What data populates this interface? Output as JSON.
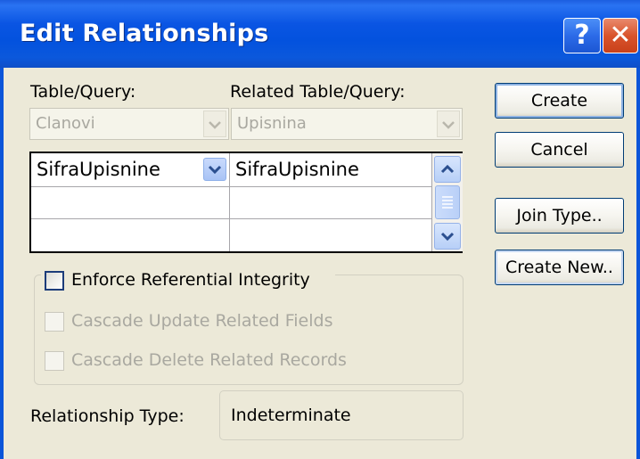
{
  "window": {
    "title": "Edit Relationships",
    "help_label": "?",
    "close_label": "✕"
  },
  "table_query": {
    "label": "Table/Query:",
    "value": "Clanovi"
  },
  "related_table_query": {
    "label": "Related Table/Query:",
    "value": "Upisnina"
  },
  "fields": {
    "rows": [
      {
        "left": "SifraUpisnine",
        "right": "SifraUpisnine"
      },
      {
        "left": "",
        "right": ""
      },
      {
        "left": "",
        "right": ""
      }
    ]
  },
  "options": {
    "enforce": {
      "label": "Enforce Referential Integrity",
      "checked": false
    },
    "cascade_update": {
      "label": "Cascade Update Related Fields",
      "checked": false,
      "disabled": true
    },
    "cascade_delete": {
      "label": "Cascade Delete Related Records",
      "checked": false,
      "disabled": true
    }
  },
  "relationship_type": {
    "label": "Relationship Type:",
    "value": "Indeterminate"
  },
  "buttons": {
    "create": "Create",
    "cancel": "Cancel",
    "join_type": "Join Type..",
    "create_new": "Create New.."
  },
  "colors": {
    "title_bar": "#0a55e3",
    "client_bg": "#ece9d8",
    "disabled_text": "#a9a8a0",
    "close_red": "#d9542c"
  }
}
